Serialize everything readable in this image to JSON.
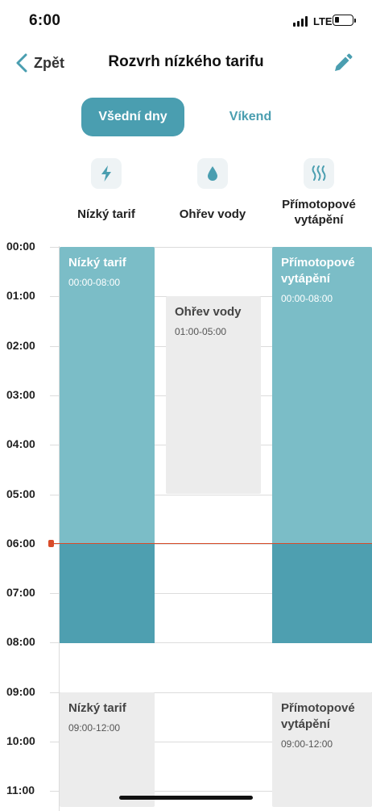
{
  "status_bar": {
    "time": "6:00",
    "network": "LTE"
  },
  "header": {
    "back_label": "Zpět",
    "title": "Rozvrh nízkého tarifu"
  },
  "tabs": [
    {
      "label": "Všední dny",
      "active": true
    },
    {
      "label": "Víkend",
      "active": false
    }
  ],
  "categories": [
    {
      "label": "Nízký tarif",
      "icon": "lightning-icon"
    },
    {
      "label": "Ohřev vody",
      "icon": "water-drop-icon"
    },
    {
      "label": "Přímotopové\nvytápění",
      "icon": "heat-waves-icon"
    }
  ],
  "hours": [
    "00:00",
    "01:00",
    "02:00",
    "03:00",
    "04:00",
    "05:00",
    "06:00",
    "07:00",
    "08:00",
    "09:00",
    "10:00",
    "11:00"
  ],
  "current_time": "06:00",
  "blocks": [
    {
      "title": "Nízký tarif",
      "range": "00:00-08:00",
      "state": "active"
    },
    {
      "title": "Ohřev vody",
      "range": "01:00-05:00",
      "state": "inactive"
    },
    {
      "title": "Přímotopové vytápění",
      "range": "00:00-08:00",
      "state": "active"
    },
    {
      "title": "Nízký tarif",
      "range": "09:00-12:00",
      "state": "inactive"
    },
    {
      "title": "Přímotopové vytápění",
      "range": "09:00-12:00",
      "state": "inactive"
    }
  ],
  "colors": {
    "accent": "#4a9eb0",
    "block_active": "#7bbdc7",
    "block_past": "#4e9fb0",
    "block_inactive": "#ececec",
    "now_line": "#d94c2a"
  }
}
